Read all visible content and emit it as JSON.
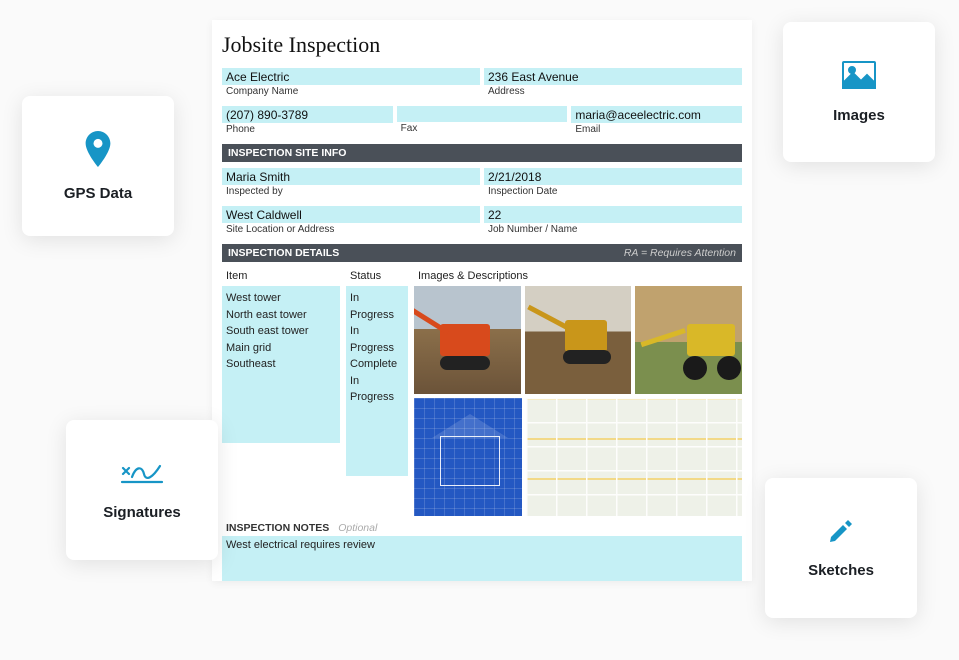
{
  "doc": {
    "title": "Jobsite Inspection",
    "company": {
      "value": "Ace Electric",
      "label": "Company Name"
    },
    "address": {
      "value": "236 East Avenue",
      "label": "Address"
    },
    "phone": {
      "value": "(207) 890-3789",
      "label": "Phone"
    },
    "fax": {
      "value": "",
      "label": "Fax"
    },
    "email": {
      "value": "maria@aceelectric.com",
      "label": "Email"
    },
    "section_site_info": "INSPECTION SITE INFO",
    "inspected_by": {
      "value": "Maria Smith",
      "label": "Inspected by"
    },
    "inspection_date": {
      "value": "2/21/2018",
      "label": "Inspection Date"
    },
    "site_location": {
      "value": "West Caldwell",
      "label": "Site Location or Address"
    },
    "job_number": {
      "value": "22",
      "label": "Job Number / Name"
    },
    "section_details": "INSPECTION DETAILS",
    "ra_note": "RA = Requires Attention",
    "col_item": "Item",
    "col_status": "Status",
    "col_images": "Images & Descriptions",
    "items": [
      {
        "item": "West tower",
        "status": "In Progress"
      },
      {
        "item": "North east tower",
        "status": "In Progress"
      },
      {
        "item": "South east tower",
        "status": "Complete"
      },
      {
        "item": "Main grid",
        "status": "In Progress"
      },
      {
        "item": "Southeast",
        "status": ""
      }
    ],
    "notes_title": "INSPECTION NOTES",
    "notes_optional": "Optional",
    "notes_body": "West electrical requires review"
  },
  "cards": {
    "gps": "GPS Data",
    "images": "Images",
    "signatures": "Signatures",
    "sketches": "Sketches"
  }
}
